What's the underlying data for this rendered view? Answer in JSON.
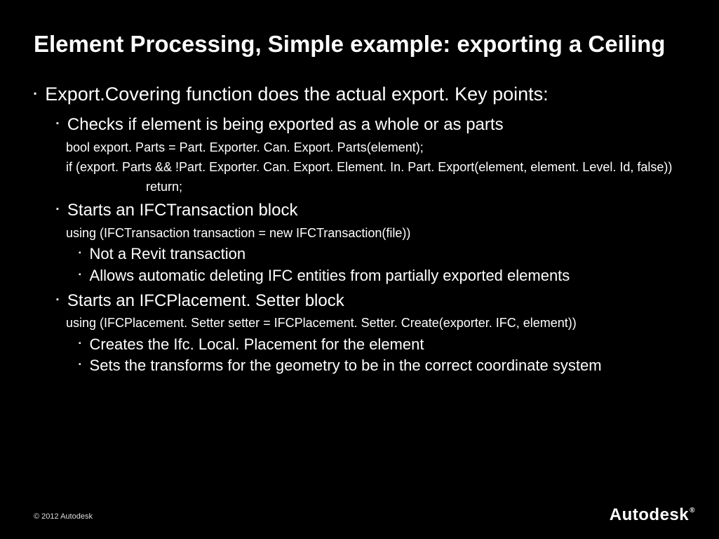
{
  "title": "Element Processing, Simple example: exporting a Ceiling",
  "b1": "Export.Covering function does the actual export.  Key points:",
  "b2a": "Checks if element is being exported as a whole or as parts",
  "code1a": "bool export. Parts = Part. Exporter. Can. Export. Parts(element);",
  "code1b": "if (export. Parts && !Part. Exporter. Can. Export. Element. In. Part. Export(element, element. Level. Id, false))",
  "code1c": "return;",
  "b2b": "Starts an IFCTransaction block",
  "code2": "using (IFCTransaction transaction = new IFCTransaction(file))",
  "b3a": "Not a Revit transaction",
  "b3b": "Allows automatic deleting IFC entities from partially exported elements",
  "b2c": "Starts an IFCPlacement. Setter block",
  "code3": "using (IFCPlacement. Setter setter = IFCPlacement. Setter. Create(exporter. IFC, element))",
  "b3c": "Creates the Ifc. Local. Placement for the element",
  "b3d": "Sets the transforms for the geometry to be in the correct  coordinate system",
  "copyright": "© 2012 Autodesk",
  "logo": "Autodesk",
  "logo_reg": "®"
}
